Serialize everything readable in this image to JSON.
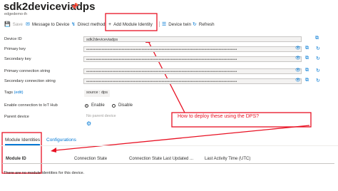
{
  "header": {
    "title": "sdk2deviceviadps",
    "subtitle": "edgedemo-ih",
    "more": "···"
  },
  "toolbar": {
    "save": "Save",
    "message": "Message to Device",
    "direct": "Direct method",
    "add_module": "Add Module Identity",
    "twin": "Device twin",
    "refresh": "Refresh"
  },
  "fields": {
    "device_id": {
      "label": "Device ID",
      "value": "sdk2deviceviadps"
    },
    "primary_key": {
      "label": "Primary key"
    },
    "secondary_key": {
      "label": "Secondary key"
    },
    "primary_conn": {
      "label": "Primary connection string"
    },
    "secondary_conn": {
      "label": "Secondary connection string"
    },
    "tags": {
      "label": "Tags",
      "edit": "(edit)",
      "value": "source : dps"
    },
    "enable": {
      "label": "Enable connection to IoT Hub",
      "on": "Enable",
      "off": "Disable",
      "selected": "Enable"
    },
    "parent": {
      "label": "Parent device",
      "value": "No parent device"
    }
  },
  "masked": "••••••••••••••••••••••••••••••••••••••••••••••••••••••••••••••••••••••••••••••••••••••••••••••••••",
  "tabs": {
    "modules": "Module Identities",
    "config": "Configurations"
  },
  "table": {
    "headers": [
      "Module ID",
      "Connection State",
      "Connection State Last Updated ...",
      "Last Activity Time (UTC)"
    ],
    "empty": "There are no module identities for this device."
  },
  "annotation": {
    "callout": "How to deploy these using the DPS?",
    "color": "#e81123"
  },
  "colors": {
    "accent": "#0078d4"
  }
}
